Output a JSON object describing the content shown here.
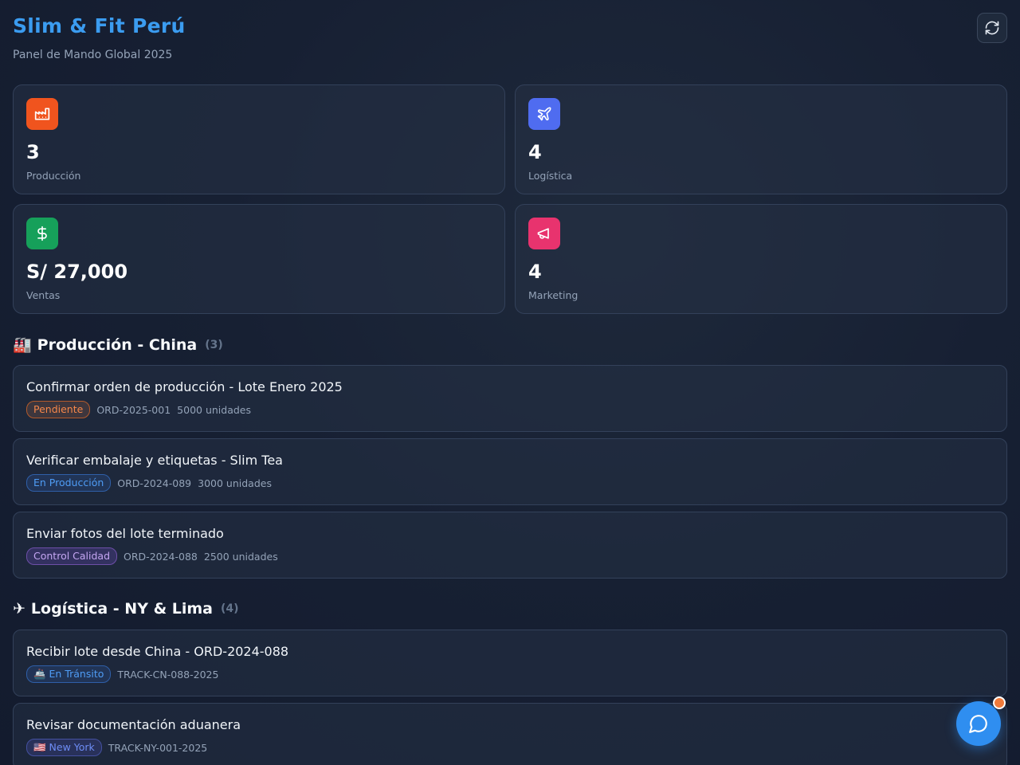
{
  "header": {
    "title": "Slim & Fit Perú",
    "subtitle": "Panel de Mando Global 2025"
  },
  "stats": [
    {
      "value": "3",
      "label": "Producción",
      "icon": "factory-icon",
      "color": "#f0541e"
    },
    {
      "value": "4",
      "label": "Logística",
      "icon": "plane-icon",
      "color": "#4f6cf0"
    },
    {
      "value": "S/ 27,000",
      "label": "Ventas",
      "icon": "dollar-icon",
      "color": "#16a05a"
    },
    {
      "value": "4",
      "label": "Marketing",
      "icon": "megaphone-icon",
      "color": "#e8336e"
    }
  ],
  "sections": {
    "produccion": {
      "emoji": "🏭",
      "title": "Producción - China",
      "count": "(3)"
    },
    "logistica": {
      "emoji": "✈",
      "title": "Logística - NY & Lima",
      "count": "(4)"
    }
  },
  "produccion_tasks": [
    {
      "title": "Confirmar orden de producción - Lote Enero 2025",
      "status": "Pendiente",
      "order": "ORD-2025-001",
      "units": "5000 unidades"
    },
    {
      "title": "Verificar embalaje y etiquetas - Slim Tea",
      "status": "En Producción",
      "order": "ORD-2024-089",
      "units": "3000 unidades"
    },
    {
      "title": "Enviar fotos del lote terminado",
      "status": "Control Calidad",
      "order": "ORD-2024-088",
      "units": "2500 unidades"
    }
  ],
  "logistica_tasks": [
    {
      "title": "Recibir lote desde China - ORD-2024-088",
      "status": "🚢 En Tránsito",
      "tracking": "TRACK-CN-088-2025"
    },
    {
      "title": "Revisar documentación aduanera",
      "status": "🇺🇸 New York",
      "tracking": "TRACK-NY-001-2025"
    }
  ]
}
